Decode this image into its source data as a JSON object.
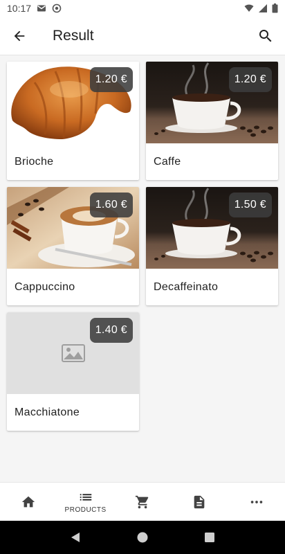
{
  "status_bar": {
    "time": "10:17",
    "icons_left": [
      "gmail-icon",
      "sync-icon"
    ],
    "icons_right": [
      "wifi-icon",
      "signal-icon",
      "battery-icon"
    ]
  },
  "app_bar": {
    "title": "Result",
    "back_icon": "arrow-back-icon",
    "search_icon": "search-icon"
  },
  "products": [
    {
      "name": "Brioche",
      "price": "1.20 €",
      "image": "croissant"
    },
    {
      "name": "Caffe",
      "price": "1.20 €",
      "image": "coffee-cup"
    },
    {
      "name": "Cappuccino",
      "price": "1.60 €",
      "image": "cappuccino"
    },
    {
      "name": "Decaffeinato",
      "price": "1.50 €",
      "image": "coffee-cup"
    },
    {
      "name": "Macchiatone",
      "price": "1.40 €",
      "image": "placeholder"
    }
  ],
  "bottom_nav": {
    "items": [
      {
        "icon": "home-icon",
        "label": ""
      },
      {
        "icon": "list-icon",
        "label": "PRODUCTS"
      },
      {
        "icon": "cart-icon",
        "label": ""
      },
      {
        "icon": "document-icon",
        "label": ""
      },
      {
        "icon": "more-icon",
        "label": ""
      }
    ]
  },
  "colors": {
    "badge_bg": "#3c3c3c",
    "background": "#f5f5f5",
    "card_bg": "#ffffff",
    "icon": "#424242"
  }
}
